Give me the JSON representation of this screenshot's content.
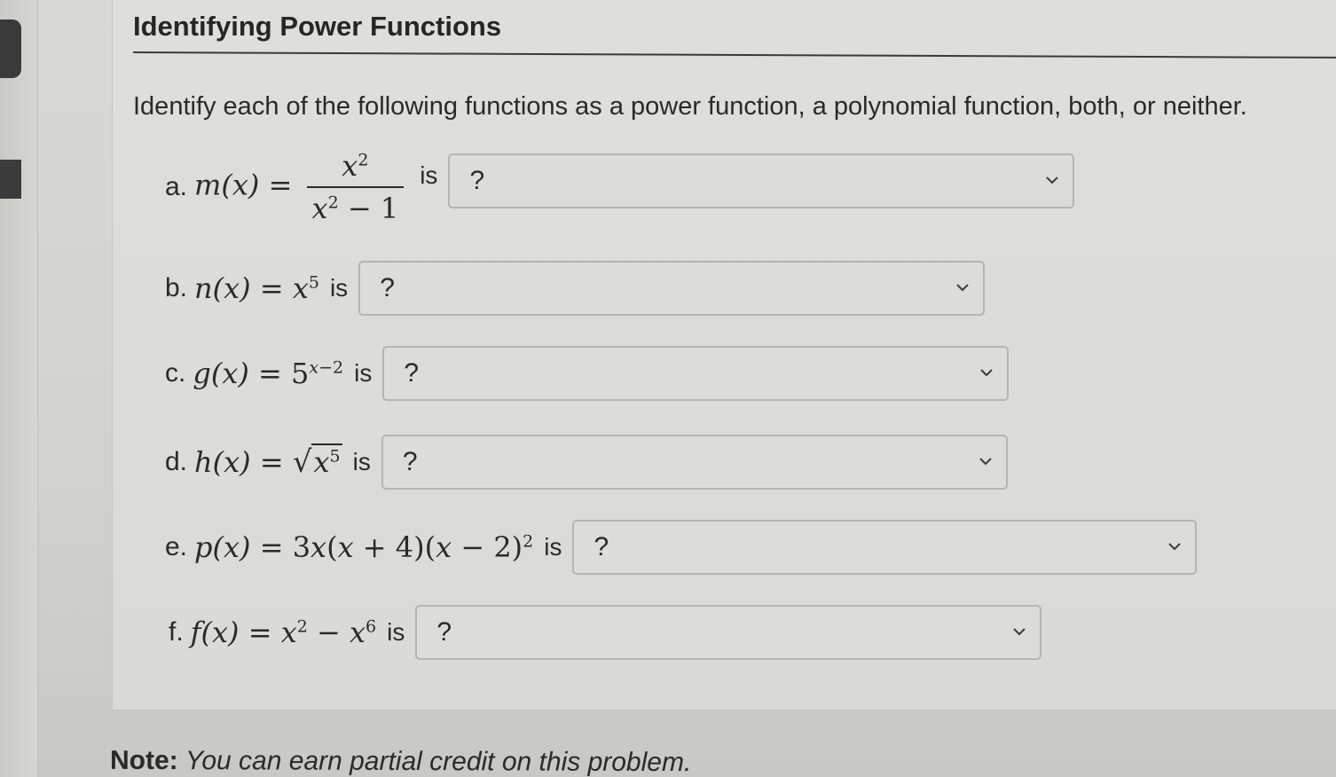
{
  "title": "Identifying Power Functions",
  "instructions": "Identify each of the following functions as a power function, a polynomial function, both, or neither.",
  "connector": "is",
  "items": [
    {
      "letter": "a.",
      "selected": "?"
    },
    {
      "letter": "b.",
      "selected": "?"
    },
    {
      "letter": "c.",
      "selected": "?"
    },
    {
      "letter": "d.",
      "selected": "?"
    },
    {
      "letter": "e.",
      "selected": "?"
    },
    {
      "letter": "f.",
      "selected": "?"
    }
  ],
  "note": {
    "label": "Note:",
    "text": "You can earn partial credit on this problem."
  },
  "icons": {
    "dropdown": "chevron-down-icon"
  }
}
